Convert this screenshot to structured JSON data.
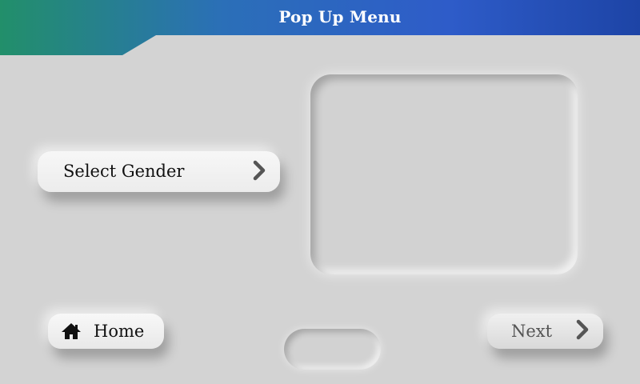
{
  "header": {
    "title": "Pop Up Menu",
    "gradient_colors": [
      "#218f6c",
      "#2f62c8",
      "#1f46a8"
    ]
  },
  "select_gender": {
    "label": "Select Gender",
    "icon": "chevron-right-icon"
  },
  "preview": {
    "content": ""
  },
  "home": {
    "label": "Home",
    "icon": "home-icon"
  },
  "next": {
    "label": "Next",
    "icon": "chevron-right-icon"
  },
  "colors": {
    "background": "#d3d3d3",
    "icon_gray": "#555555"
  }
}
